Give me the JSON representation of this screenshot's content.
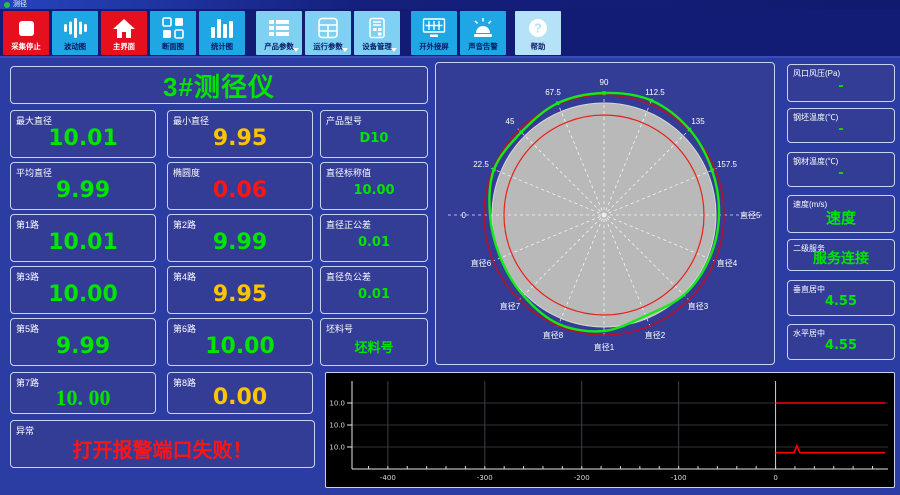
{
  "window": {
    "title": "测径"
  },
  "toolbar": {
    "buttons": [
      {
        "label": "采集停止",
        "icon": "stop-icon",
        "variant": "red"
      },
      {
        "label": "波动图",
        "icon": "waveform-icon",
        "variant": "blue"
      },
      {
        "label": "主界面",
        "icon": "home-icon",
        "variant": "red"
      },
      {
        "label": "断面图",
        "icon": "grid-views-icon",
        "variant": "blue"
      },
      {
        "label": "统计图",
        "icon": "bar-chart-icon",
        "variant": "blue"
      },
      {
        "label": "产品参数",
        "icon": "list-icon",
        "variant": "light",
        "caret": true
      },
      {
        "label": "运行参数",
        "icon": "table-icon",
        "variant": "light",
        "caret": true
      },
      {
        "label": "设备管理",
        "icon": "device-icon",
        "variant": "light",
        "caret": true
      },
      {
        "label": "开外接屏",
        "icon": "external-screen-icon",
        "variant": "blue"
      },
      {
        "label": "声音告警",
        "icon": "alarm-siren-icon",
        "variant": "blue"
      },
      {
        "label": "帮助",
        "icon": "help-icon",
        "variant": "pale"
      }
    ]
  },
  "main_title": "3#测径仪",
  "fields": [
    {
      "label": "最大直径",
      "value": "10.01",
      "color": "#00e400"
    },
    {
      "label": "最小直径",
      "value": "9.95",
      "color": "#ffc400"
    },
    {
      "label": "产品型号",
      "value": "D10",
      "color": "#00e400"
    },
    {
      "label": "平均直径",
      "value": "9.99",
      "color": "#00e400"
    },
    {
      "label": "椭圆度",
      "value": "0.06",
      "color": "#ff1414"
    },
    {
      "label": "直径标称值",
      "value": "10.00",
      "color": "#00e400"
    },
    {
      "label": "第1路",
      "value": "10.01",
      "color": "#00e400"
    },
    {
      "label": "第2路",
      "value": "9.99",
      "color": "#00e400"
    },
    {
      "label": "直径正公差",
      "value": "0.01",
      "color": "#00e400"
    },
    {
      "label": "第3路",
      "value": "10.00",
      "color": "#00e400"
    },
    {
      "label": "第4路",
      "value": "9.95",
      "color": "#ffc400"
    },
    {
      "label": "直径负公差",
      "value": "0.01",
      "color": "#00e400"
    },
    {
      "label": "第5路",
      "value": "9.99",
      "color": "#00e400"
    },
    {
      "label": "第6路",
      "value": "10.00",
      "color": "#00e400"
    },
    {
      "label": "坯料号",
      "value": "坯料号",
      "color": "#00e400"
    },
    {
      "label": "第7路",
      "value": "10. 00",
      "color": "#00e400"
    },
    {
      "label": "第8路",
      "value": "0.00",
      "color": "#ffc400"
    }
  ],
  "alarm": {
    "label": "异常",
    "message": "打开报警端口失败！",
    "color": "#ff1414"
  },
  "right_panel": {
    "items": [
      {
        "label": "风口风压(Pa)",
        "value": "-",
        "color": "#00e400"
      },
      {
        "label": "钢坯温度(℃)",
        "value": "-",
        "color": "#00e400"
      },
      {
        "label": "钢材温度(℃)",
        "value": "-",
        "color": "#00e400"
      },
      {
        "label": "速度(m/s)",
        "value": "速度",
        "color": "#00e400"
      },
      {
        "label": "二级服务",
        "value": "服务连接",
        "color": "#00e400"
      },
      {
        "label": "垂直居中",
        "value": "4.55",
        "color": "#00e400"
      },
      {
        "label": "水平居中",
        "value": "4.55",
        "color": "#00e400"
      }
    ]
  },
  "chart_data": [
    {
      "type": "polar-profile",
      "description": "cross-section profile of rod vs nominal and tolerance circles",
      "nominal_diameter": 10.0,
      "tolerance_plus": 0.01,
      "tolerance_minus": 0.01,
      "channel_values": [
        10.01,
        9.99,
        10.0,
        9.95,
        9.99,
        10.0,
        10.0,
        0.0
      ],
      "angle_step_deg": 22.5,
      "profile_r_rel": [
        1.027,
        1.045,
        1.08,
        1.107,
        1.089,
        1.08,
        1.045,
        1.063,
        1.018,
        1.0,
        1.018,
        1.054,
        1.036,
        0.973,
        1.009,
        1.018
      ],
      "angle_labels": [
        "0",
        "22.5",
        "45",
        "67.5",
        "90",
        "112.5",
        "135",
        "157.5"
      ],
      "right_label": "直径5",
      "diameter_labels": [
        "直径6",
        "直径7",
        "直径8",
        "直径1",
        "直径2",
        "直径3",
        "直径4"
      ],
      "colors": {
        "profile": "#16e916",
        "nominal": "#e82219",
        "tolerance": "#b3112d",
        "body": "#b9b9b9",
        "spokes": "#ffffff"
      }
    },
    {
      "type": "line",
      "description": "length trend chart, diameter vs position (mm)",
      "x_ticks": [
        -400,
        -300,
        -200,
        -100,
        0
      ],
      "x_range": [
        -437,
        116
      ],
      "x_minor_start": -420,
      "x_minor_end": 100,
      "x_minor_step": 20,
      "y_tick_labels": [
        "10.0",
        "10.0",
        "10.0"
      ],
      "y_tick_values": [
        10.05,
        10.0,
        9.95
      ],
      "y_range": [
        9.9,
        10.1
      ],
      "series": [
        {
          "name": "upper-limit-trace",
          "color": "#ff0000",
          "points": [
            [
              0,
              10.05
            ],
            [
              113,
              10.05
            ]
          ]
        },
        {
          "name": "lower-trace",
          "color": "#ff0000",
          "points": [
            [
              0,
              9.937
            ],
            [
              19,
              9.937
            ],
            [
              22,
              9.953
            ],
            [
              25,
              9.937
            ],
            [
              113,
              9.937
            ]
          ]
        }
      ],
      "bg": "#000000",
      "grid": true,
      "legend": "none"
    }
  ]
}
